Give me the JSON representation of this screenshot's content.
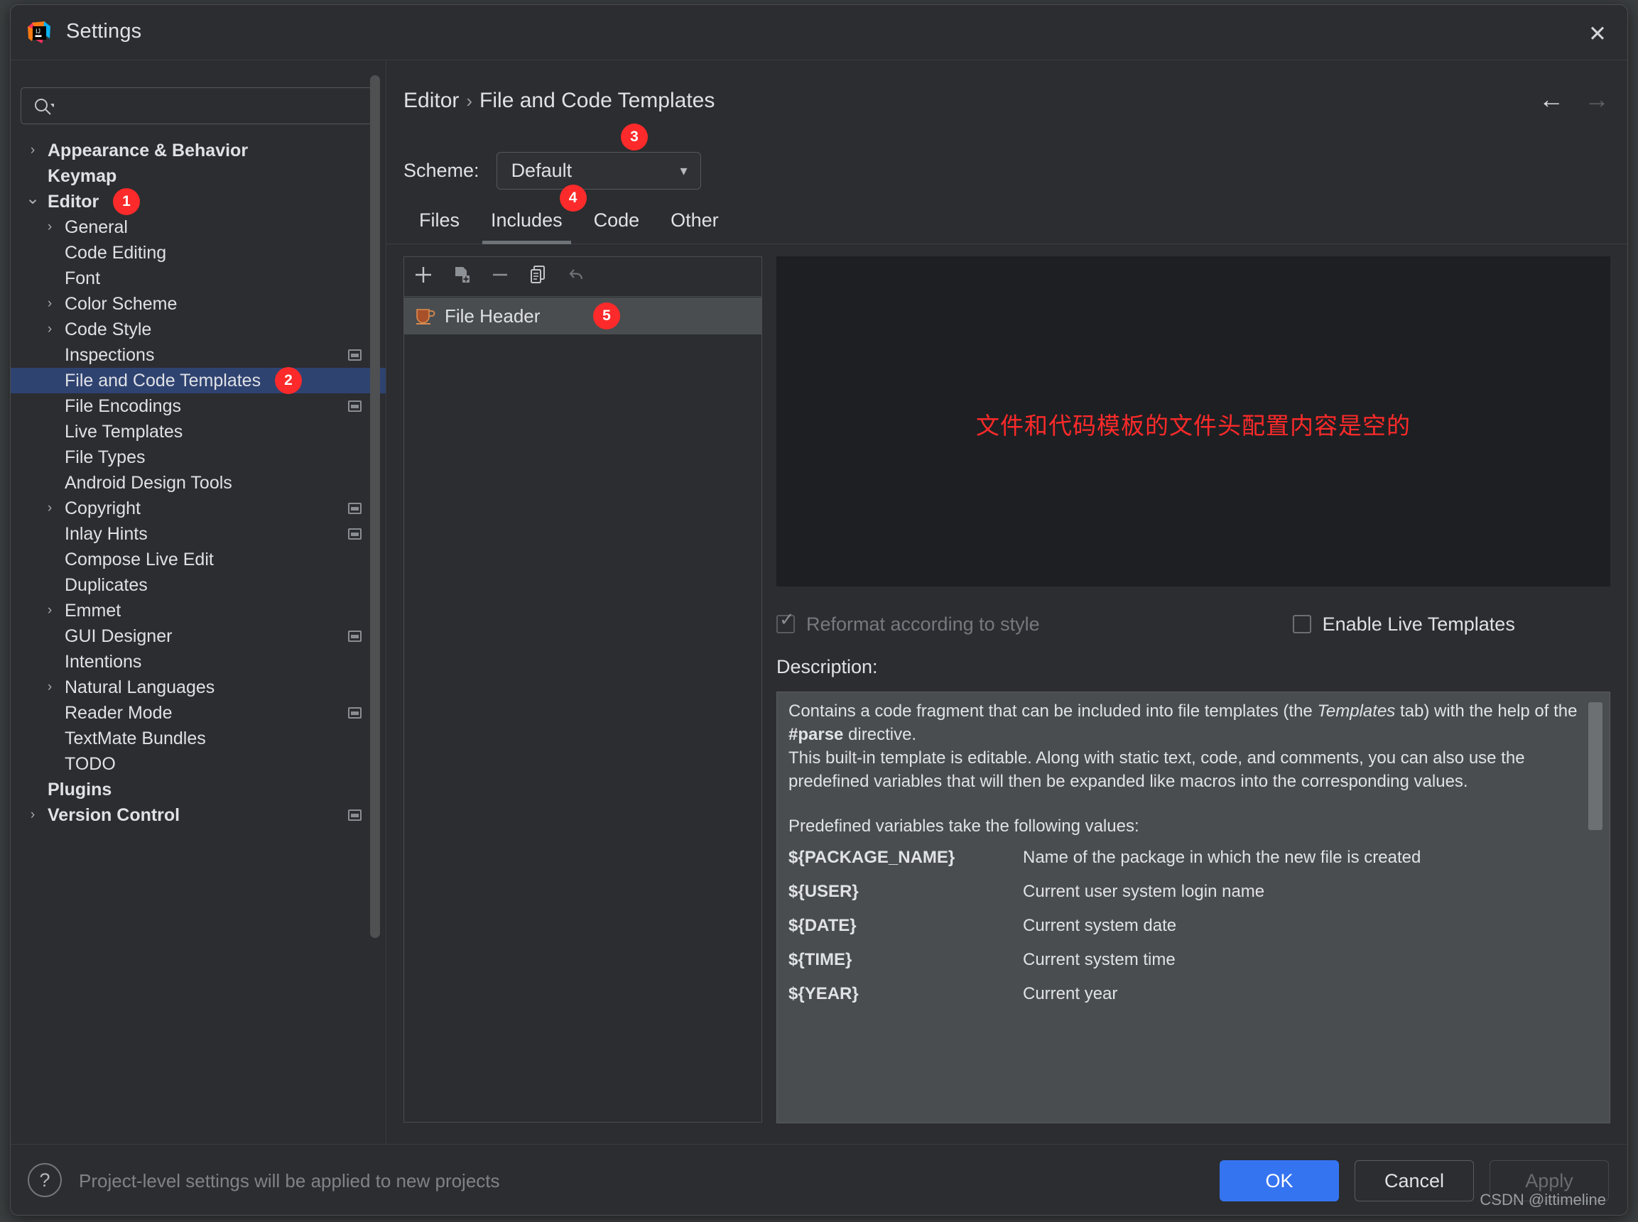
{
  "window": {
    "title": "Settings",
    "logo_icon": "jetbrains-idea-icon",
    "close_icon": "close-icon"
  },
  "search": {
    "value": "",
    "placeholder": "",
    "icon": "search-icon"
  },
  "sidebar": {
    "scrollbar": "vertical-scrollbar",
    "items": [
      {
        "label": "Appearance & Behavior",
        "indent": 52,
        "chev": "collapsed",
        "bold": true,
        "project": false,
        "selected": false,
        "badge": null
      },
      {
        "label": "Keymap",
        "indent": 52,
        "chev": "none",
        "bold": true,
        "project": false,
        "selected": false,
        "badge": null
      },
      {
        "label": "Editor",
        "indent": 52,
        "chev": "expanded",
        "bold": true,
        "project": false,
        "selected": false,
        "badge": "1"
      },
      {
        "label": "General",
        "indent": 76,
        "chev": "collapsed",
        "bold": false,
        "project": false,
        "selected": false,
        "badge": null
      },
      {
        "label": "Code Editing",
        "indent": 76,
        "chev": "none",
        "bold": false,
        "project": false,
        "selected": false,
        "badge": null
      },
      {
        "label": "Font",
        "indent": 76,
        "chev": "none",
        "bold": false,
        "project": false,
        "selected": false,
        "badge": null
      },
      {
        "label": "Color Scheme",
        "indent": 76,
        "chev": "collapsed",
        "bold": false,
        "project": false,
        "selected": false,
        "badge": null
      },
      {
        "label": "Code Style",
        "indent": 76,
        "chev": "collapsed",
        "bold": false,
        "project": false,
        "selected": false,
        "badge": null
      },
      {
        "label": "Inspections",
        "indent": 76,
        "chev": "none",
        "bold": false,
        "project": true,
        "selected": false,
        "badge": null
      },
      {
        "label": "File and Code Templates",
        "indent": 76,
        "chev": "none",
        "bold": false,
        "project": false,
        "selected": true,
        "badge": "2"
      },
      {
        "label": "File Encodings",
        "indent": 76,
        "chev": "none",
        "bold": false,
        "project": true,
        "selected": false,
        "badge": null
      },
      {
        "label": "Live Templates",
        "indent": 76,
        "chev": "none",
        "bold": false,
        "project": false,
        "selected": false,
        "badge": null
      },
      {
        "label": "File Types",
        "indent": 76,
        "chev": "none",
        "bold": false,
        "project": false,
        "selected": false,
        "badge": null
      },
      {
        "label": "Android Design Tools",
        "indent": 76,
        "chev": "none",
        "bold": false,
        "project": false,
        "selected": false,
        "badge": null
      },
      {
        "label": "Copyright",
        "indent": 76,
        "chev": "collapsed",
        "bold": false,
        "project": true,
        "selected": false,
        "badge": null
      },
      {
        "label": "Inlay Hints",
        "indent": 76,
        "chev": "none",
        "bold": false,
        "project": true,
        "selected": false,
        "badge": null
      },
      {
        "label": "Compose Live Edit",
        "indent": 76,
        "chev": "none",
        "bold": false,
        "project": false,
        "selected": false,
        "badge": null
      },
      {
        "label": "Duplicates",
        "indent": 76,
        "chev": "none",
        "bold": false,
        "project": false,
        "selected": false,
        "badge": null
      },
      {
        "label": "Emmet",
        "indent": 76,
        "chev": "collapsed",
        "bold": false,
        "project": false,
        "selected": false,
        "badge": null
      },
      {
        "label": "GUI Designer",
        "indent": 76,
        "chev": "none",
        "bold": false,
        "project": true,
        "selected": false,
        "badge": null
      },
      {
        "label": "Intentions",
        "indent": 76,
        "chev": "none",
        "bold": false,
        "project": false,
        "selected": false,
        "badge": null
      },
      {
        "label": "Natural Languages",
        "indent": 76,
        "chev": "collapsed",
        "bold": false,
        "project": false,
        "selected": false,
        "badge": null
      },
      {
        "label": "Reader Mode",
        "indent": 76,
        "chev": "none",
        "bold": false,
        "project": true,
        "selected": false,
        "badge": null
      },
      {
        "label": "TextMate Bundles",
        "indent": 76,
        "chev": "none",
        "bold": false,
        "project": false,
        "selected": false,
        "badge": null
      },
      {
        "label": "TODO",
        "indent": 76,
        "chev": "none",
        "bold": false,
        "project": false,
        "selected": false,
        "badge": null
      },
      {
        "label": "Plugins",
        "indent": 52,
        "chev": "none",
        "bold": true,
        "project": false,
        "selected": false,
        "badge": null
      },
      {
        "label": "Version Control",
        "indent": 52,
        "chev": "collapsed",
        "bold": true,
        "project": true,
        "selected": false,
        "badge": null
      }
    ]
  },
  "breadcrumb": {
    "parent": "Editor",
    "separator": "›",
    "current": "File and Code Templates"
  },
  "nav": {
    "back_icon": "arrow-left-icon",
    "forward_icon": "arrow-right-icon"
  },
  "scheme": {
    "label": "Scheme:",
    "value": "Default",
    "chevron_icon": "chevron-down-icon",
    "badge": "3"
  },
  "tabs": [
    {
      "label": "Files",
      "active": false,
      "badge": null
    },
    {
      "label": "Includes",
      "active": true,
      "badge": "4"
    },
    {
      "label": "Code",
      "active": false,
      "badge": null
    },
    {
      "label": "Other",
      "active": false,
      "badge": null
    }
  ],
  "list_toolbar": [
    {
      "icon": "plus-icon",
      "name": "add-template-button"
    },
    {
      "icon": "copy-file-icon",
      "name": "create-child-template-button"
    },
    {
      "icon": "minus-icon",
      "name": "remove-template-button"
    },
    {
      "icon": "duplicate-icon",
      "name": "copy-template-button"
    },
    {
      "icon": "undo-icon",
      "name": "reset-to-default-button"
    }
  ],
  "templates": [
    {
      "label": "File Header",
      "icon": "coffee-cup-icon",
      "selected": true,
      "badge": "5"
    }
  ],
  "editor": {
    "message": "文件和代码模板的文件头配置内容是空的",
    "message_color": "#fc2a2a",
    "value": ""
  },
  "checkboxes": [
    {
      "label": "Reformat according to style",
      "checked": true,
      "disabled": true
    },
    {
      "label": "Enable Live Templates",
      "checked": false,
      "disabled": false
    }
  ],
  "description": {
    "label": "Description:",
    "paragraph1_a": "Contains a code fragment that can be included into file templates (the ",
    "paragraph1_em": "Templates",
    "paragraph1_b": " tab) with the help of the ",
    "paragraph1_bold": "#parse",
    "paragraph1_c": " directive.",
    "paragraph2": "This built-in template is editable. Along with static text, code, and comments, you can also use the predefined variables that will then be expanded like macros into the corresponding values.",
    "paragraph3": "Predefined variables take the following values:",
    "variables": [
      {
        "name": "${PACKAGE_NAME}",
        "desc": "Name of the package in which the new file is created"
      },
      {
        "name": "${USER}",
        "desc": "Current user system login name"
      },
      {
        "name": "${DATE}",
        "desc": "Current system date"
      },
      {
        "name": "${TIME}",
        "desc": "Current system time"
      },
      {
        "name": "${YEAR}",
        "desc": "Current year"
      }
    ]
  },
  "bottom": {
    "help_icon": "question-mark-icon",
    "note": "Project-level settings will be applied to new projects",
    "buttons": [
      {
        "label": "OK",
        "style": "primary"
      },
      {
        "label": "Cancel",
        "style": "normal"
      },
      {
        "label": "Apply",
        "style": "disabled"
      }
    ]
  },
  "watermark": "CSDN @ittimeline",
  "colors": {
    "accent": "#3574f0",
    "badge": "#fc2a2a",
    "selection": "#2f4371",
    "editor_bg": "#1e1f22"
  }
}
